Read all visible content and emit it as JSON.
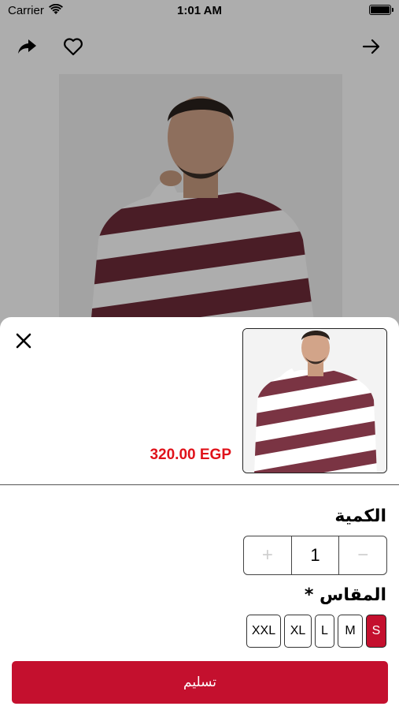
{
  "status": {
    "carrier": "Carrier",
    "time": "1:01 AM"
  },
  "nav": {
    "share_icon": "share-icon",
    "heart_icon": "heart-icon",
    "forward_icon": "arrow-right-icon"
  },
  "sheet": {
    "close_icon": "close-icon",
    "price": "320.00 EGP",
    "quantity_title": "الكمية",
    "quantity": {
      "increment": "+",
      "value": "1",
      "decrement": "−"
    },
    "size_title": "المقاس *",
    "sizes": [
      "XXL",
      "XL",
      "L",
      "M",
      "S"
    ],
    "selected_size": "S",
    "submit_label": "تسليم"
  },
  "colors": {
    "accent": "#c4102e",
    "price": "#e0121a"
  }
}
